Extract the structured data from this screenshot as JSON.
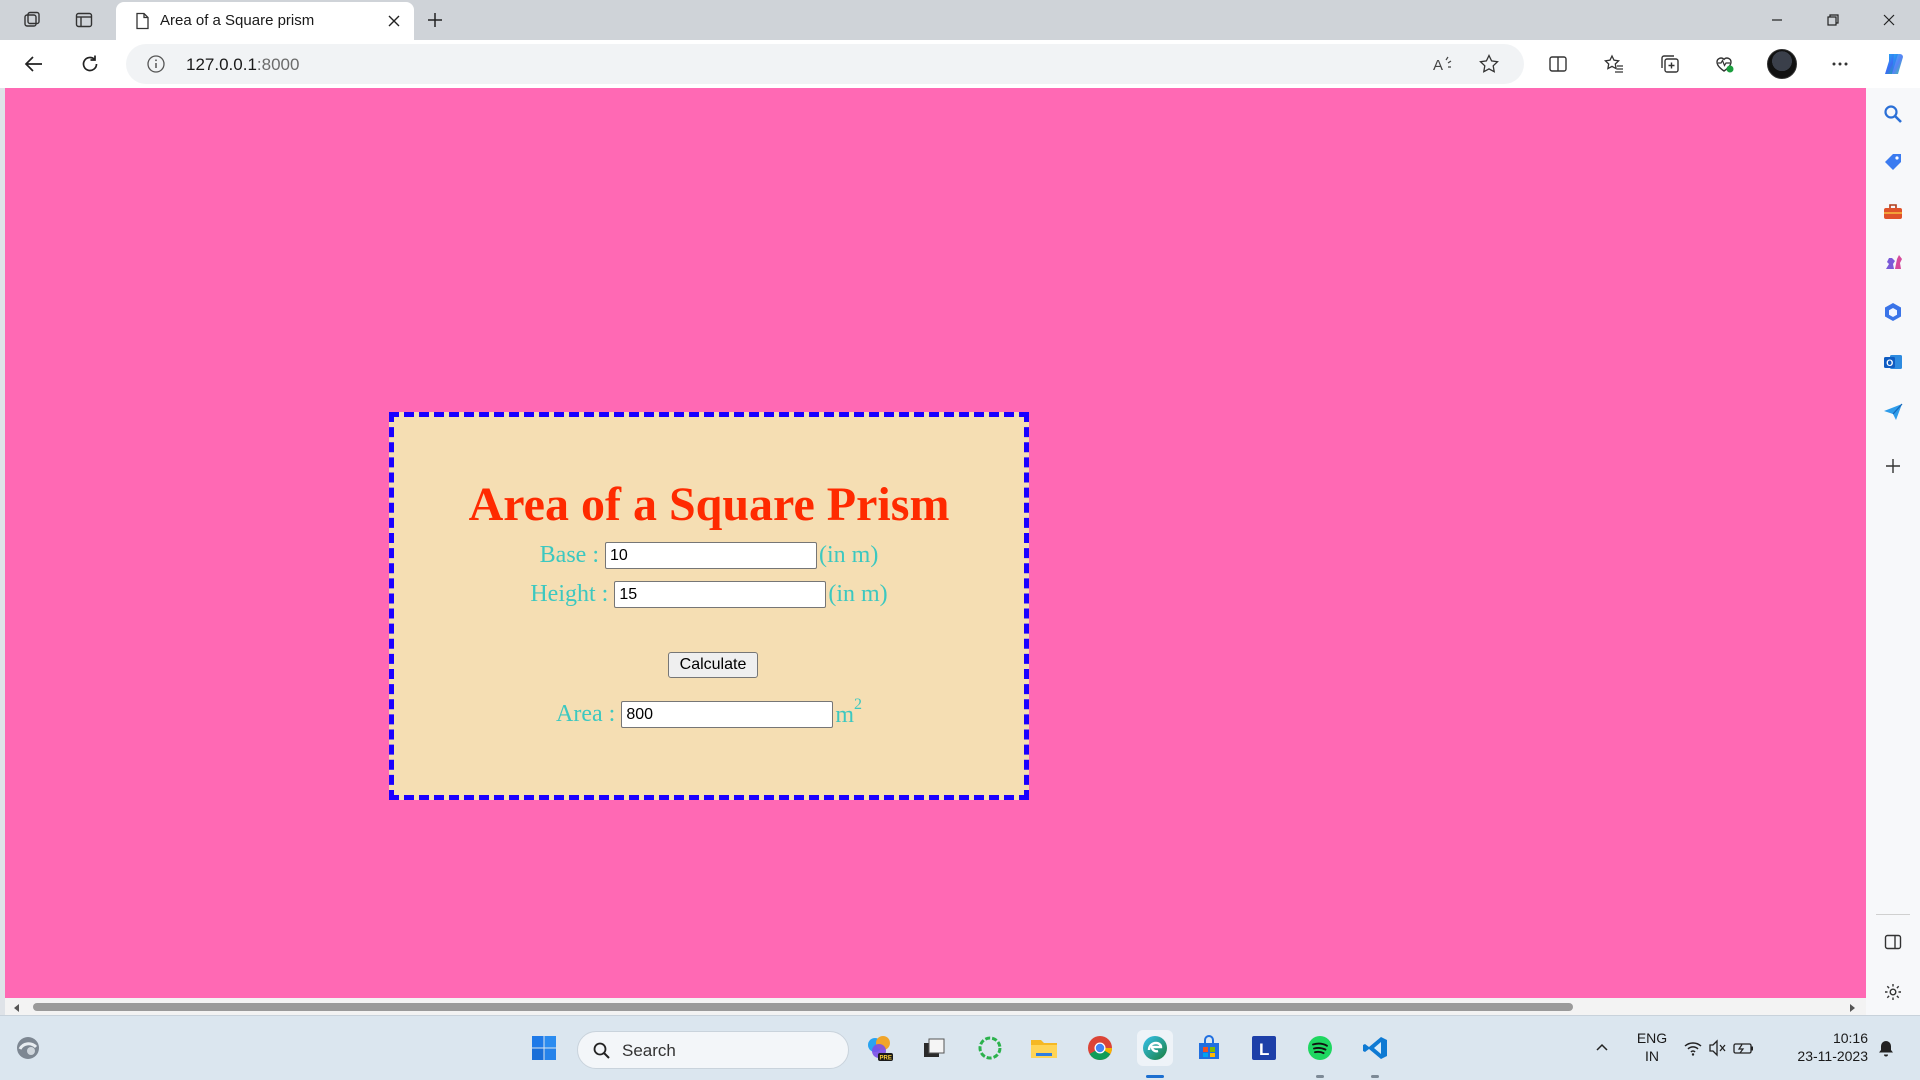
{
  "browser": {
    "tab_title": "Area of a Square prism",
    "url_host": "127.0.0.1",
    "url_port": ":8000"
  },
  "page": {
    "title": "Area of a Square Prism",
    "base_label": "Base :",
    "base_value": "10",
    "height_label": "Height :",
    "height_value": "15",
    "unit_label": "(in m)",
    "calculate_label": "Calculate",
    "area_label": "Area :",
    "area_value": "800",
    "area_unit": "m",
    "area_unit_power": "2"
  },
  "taskbar": {
    "search_placeholder": "Search",
    "language_line1": "ENG",
    "language_line2": "IN",
    "time": "10:16",
    "date": "23-11-2023"
  },
  "colors": {
    "page_background": "#ff69b4",
    "card_background": "#f5deb3",
    "card_border": "#1a00ff",
    "title": "#ff2a00",
    "labels": "#3cc8c0"
  }
}
